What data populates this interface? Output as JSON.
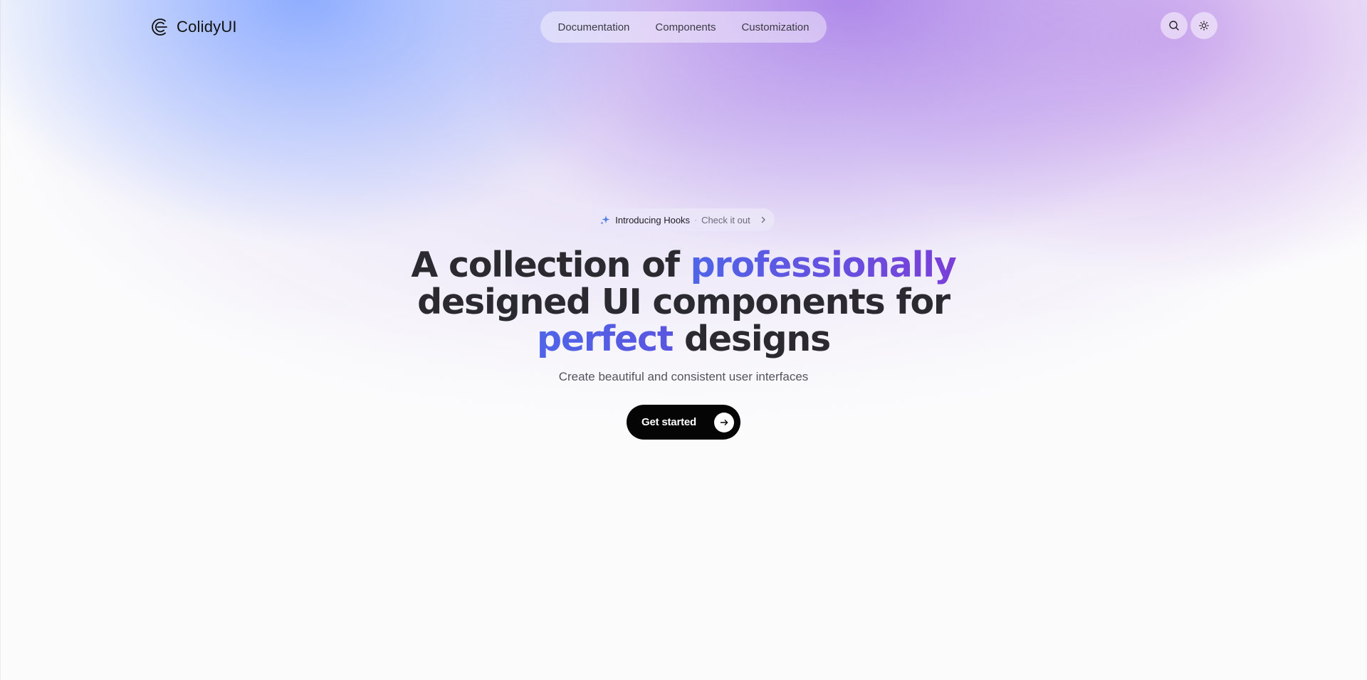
{
  "brand": {
    "name": "ColidyUI"
  },
  "nav": {
    "items": [
      {
        "label": "Documentation"
      },
      {
        "label": "Components"
      },
      {
        "label": "Customization"
      }
    ]
  },
  "header_actions": {
    "search_icon": "search-icon",
    "theme_icon": "sun-icon"
  },
  "announcement": {
    "title": "Introducing Hooks",
    "separator": "·",
    "link": "Check it out"
  },
  "hero": {
    "line1_prefix": "A collection of",
    "line1_accent": "professionally",
    "line2": "designed UI components for",
    "line3_accent": "perfect",
    "line3_suffix": "designs",
    "subtitle": "Create beautiful and consistent user interfaces",
    "cta_label": "Get started"
  },
  "colors": {
    "accent_start": "#4f65e8",
    "accent_end": "#7a3fd8",
    "cta_bg": "#050505",
    "text": "#2a2a30"
  }
}
